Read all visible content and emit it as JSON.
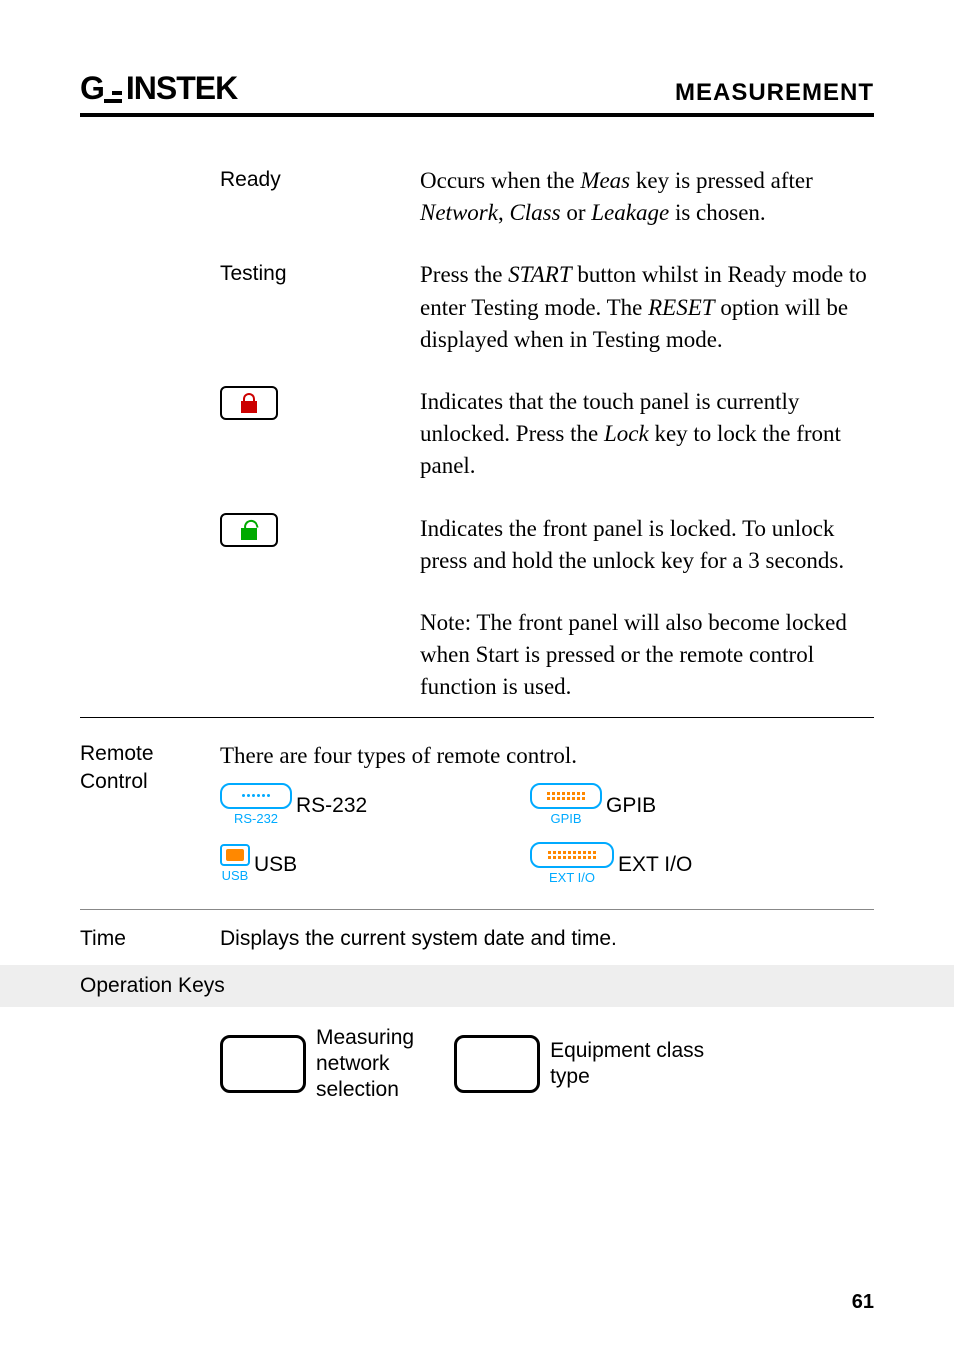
{
  "header": {
    "brand": "GW INSTEK",
    "section": "MEASUREMENT"
  },
  "rows": [
    {
      "label": "Ready",
      "desc_html": "Occurs when the <span class=\"italic\">Meas</span> key is pressed after <span class=\"italic\">Network</span>, <span class=\"italic\">Class</span> or <span class=\"italic\">Leakage</span> is chosen."
    },
    {
      "label": "Testing",
      "desc_html": "Press the <span class=\"italic\">START</span> button whilst in Ready mode to enter Testing mode. The <span class=\"italic\">RESET</span> option will be displayed when in Testing mode."
    },
    {
      "icon": "unlocked",
      "desc_html": "Indicates that the touch panel is currently unlocked. Press the <span class=\"italic\">Lock</span> key to lock the front panel."
    },
    {
      "icon": "locked",
      "desc_html": "Indicates the front panel is locked. To unlock press and hold the unlock key for a 3 seconds."
    },
    {
      "desc_html": "Note: The front panel will also become locked when Start is pressed or the remote control function is used."
    }
  ],
  "remote": {
    "heading": "Remote Control",
    "intro": "There are four types of remote control.",
    "items": [
      {
        "port_label": "RS-232",
        "text": "RS-232",
        "style": "dots"
      },
      {
        "port_label": "GPIB",
        "text": "GPIB",
        "style": "dashes"
      },
      {
        "port_label": "USB",
        "text": "USB",
        "style": "usb"
      },
      {
        "port_label": "EXT I/O",
        "text": "EXT I/O",
        "style": "dashes-wide"
      }
    ]
  },
  "time": {
    "label": "Time",
    "desc": "Displays the current system date and time."
  },
  "opkeys": {
    "heading": "Operation Keys",
    "items": [
      {
        "label": "Measuring network selection"
      },
      {
        "label": "Equipment class type"
      }
    ]
  },
  "page": "61"
}
